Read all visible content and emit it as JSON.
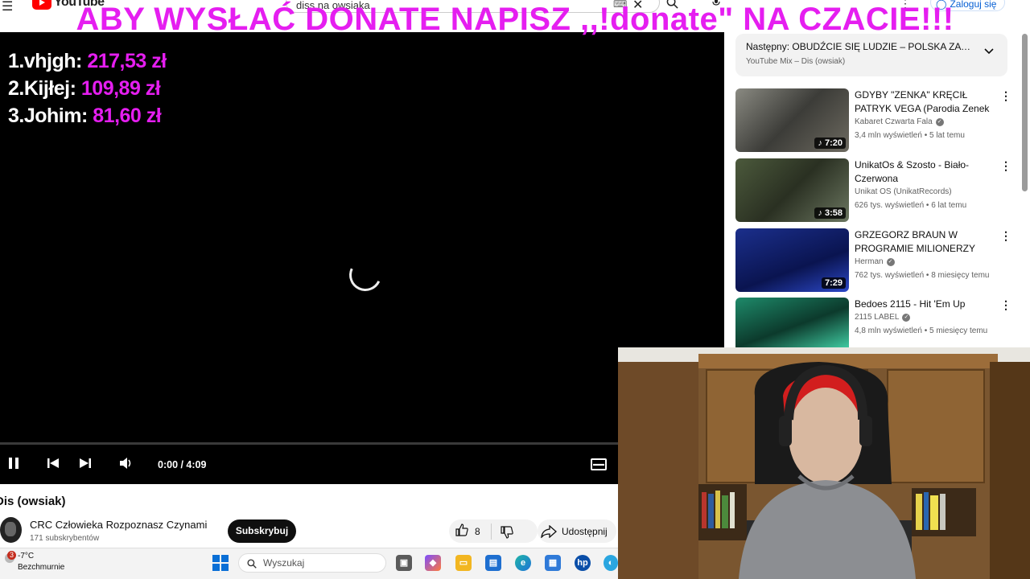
{
  "youtube": {
    "logo_text": "YouTube",
    "search_value": "diss na owsiaka",
    "signin_label": "Zaloguj się"
  },
  "overlay": {
    "banner": "ABY WYSŁAĆ DONATE NAPISZ ,,!donate\" NA CZACIE!!!",
    "leaderboard": [
      {
        "rank": "1.",
        "name": "vhjgh:",
        "amount": "217,53 zł"
      },
      {
        "rank": "2.",
        "name": "Kijłej:",
        "amount": "109,89 zł"
      },
      {
        "rank": "3.",
        "name": "Johim:",
        "amount": "81,60 zł"
      }
    ],
    "accent_color": "#e51ef0"
  },
  "player": {
    "time": "0:00 / 4:09",
    "progress": 0,
    "state": "playing-loading"
  },
  "video": {
    "title": "Dis (owsiak)",
    "channel": "CRC Człowieka Rozpoznasz Czynami",
    "subscribers": "171 subskrybentów",
    "subscribe_label": "Subskrybuj",
    "likes": "8",
    "share_label": "Udostępnij"
  },
  "playlist": {
    "next_prefix": "Następny:",
    "next_title": "OBUDŹCIE SIĘ LUDZIE – POLSKA ZAWS...",
    "subtitle": "YouTube Mix – Dis (owsiak)"
  },
  "recommendations": [
    {
      "title": "GDYBY \"ZENKA\" KRĘCIŁ PATRYK VEGA (Parodia Zenek ...",
      "channel": "Kabaret Czwarta Fala",
      "verified": true,
      "views": "3,4 mln wyświetleń",
      "age": "5 lat temu",
      "duration": "7:20",
      "music": true
    },
    {
      "title": "UnikatOs & Szosto - Biało-Czerwona",
      "channel": "Unikat OS (UnikatRecords)",
      "verified": false,
      "views": "626 tys. wyświetleń",
      "age": "6 lat temu",
      "duration": "3:58",
      "music": true
    },
    {
      "title": "GRZEGORZ BRAUN W PROGRAMIE MILIONERZY",
      "channel": "Herman",
      "verified": true,
      "views": "762 tys. wyświetleń",
      "age": "8 miesięcy temu",
      "duration": "7:29",
      "music": false
    },
    {
      "title": "Bedoes 2115 - Hit 'Em Up",
      "channel": "2115 LABEL",
      "verified": true,
      "views": "4,8 mln wyświetleń",
      "age": "5 miesięcy temu",
      "duration": "",
      "music": false
    }
  ],
  "taskbar": {
    "weather_badge": "3",
    "temperature": "-7°C",
    "condition": "Bezchmurnie",
    "search_placeholder": "Wyszukaj"
  }
}
